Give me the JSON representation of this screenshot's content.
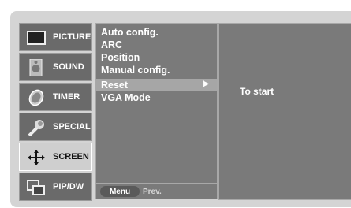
{
  "menu": {
    "items": [
      {
        "label": "PICTURE",
        "icon": "picture-icon",
        "selected": false
      },
      {
        "label": "SOUND",
        "icon": "sound-icon",
        "selected": false
      },
      {
        "label": "TIMER",
        "icon": "timer-icon",
        "selected": false
      },
      {
        "label": "SPECIAL",
        "icon": "special-icon",
        "selected": false
      },
      {
        "label": "SCREEN",
        "icon": "screen-icon",
        "selected": true
      },
      {
        "label": "PIP/DW",
        "icon": "pip-icon",
        "selected": false
      }
    ]
  },
  "submenu": {
    "options": [
      "Auto config.",
      "ARC",
      "Position",
      "Manual config.",
      "Reset",
      "VGA Mode"
    ],
    "highlighted": "Reset",
    "arrow": "▶"
  },
  "footer": {
    "menu_label": "Menu",
    "prev_label": "Prev."
  },
  "detail": {
    "text": "To start"
  },
  "colors": {
    "panel": "#7a7a7a",
    "selected_bg": "#cfcfcf",
    "highlight": "#a6a6a6"
  }
}
